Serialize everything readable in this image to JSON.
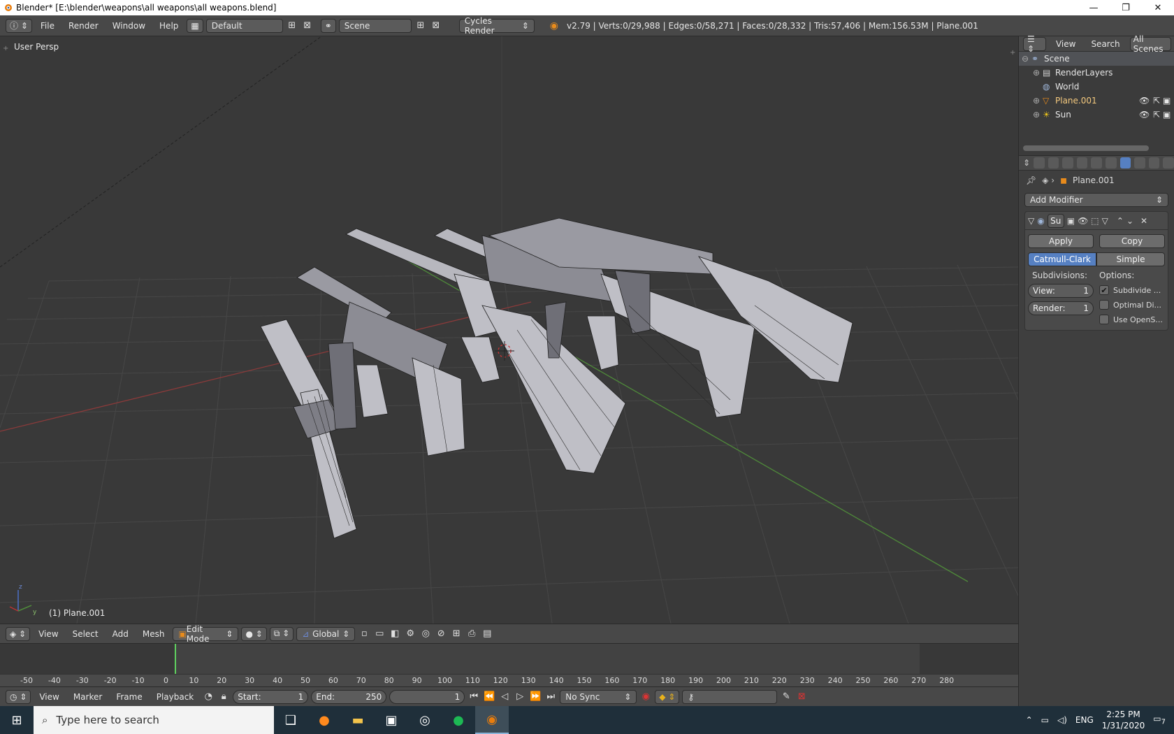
{
  "window": {
    "title": "Blender* [E:\\blender\\weapons\\all weapons\\all weapons.blend]",
    "controls": [
      "—",
      "❐",
      "✕"
    ]
  },
  "info_header": {
    "menus": [
      "File",
      "Render",
      "Window",
      "Help"
    ],
    "layout": "Default",
    "scene": "Scene",
    "engine": "Cycles Render",
    "stats": "v2.79 | Verts:0/29,988 | Edges:0/58,271 | Faces:0/28,332 | Tris:57,406 | Mem:156.53M | Plane.001"
  },
  "viewport": {
    "view_label": "User Persp",
    "object_label": "(1) Plane.001",
    "colors": {
      "background": "#393939",
      "grid": "#4a4a4a",
      "x_axis": "#8a3a3a",
      "y_axis": "#4f8a3a"
    }
  },
  "viewport_header": {
    "menus": [
      "View",
      "Select",
      "Add",
      "Mesh"
    ],
    "mode": "Edit Mode",
    "orientation": "Global"
  },
  "timeline": {
    "ticks": [
      "-50",
      "-40",
      "-30",
      "-20",
      "-10",
      "0",
      "10",
      "20",
      "30",
      "40",
      "50",
      "60",
      "70",
      "80",
      "90",
      "100",
      "110",
      "120",
      "130",
      "140",
      "150",
      "160",
      "170",
      "180",
      "190",
      "200",
      "210",
      "220",
      "230",
      "240",
      "250",
      "260",
      "270",
      "280"
    ],
    "current_frame_value": 0,
    "menus": [
      "View",
      "Marker",
      "Frame",
      "Playback"
    ],
    "start_label": "Start:",
    "start_value": "1",
    "end_label": "End:",
    "end_value": "250",
    "current_frame": "1",
    "sync": "No Sync"
  },
  "outliner": {
    "menus": [
      "View",
      "Search"
    ],
    "filter": "All Scenes",
    "items": [
      {
        "label": "Scene",
        "icon": "scene-icon"
      },
      {
        "label": "RenderLayers",
        "icon": "renderlayers-icon"
      },
      {
        "label": "World",
        "icon": "world-icon"
      },
      {
        "label": "Plane.001",
        "icon": "mesh-icon"
      },
      {
        "label": "Sun",
        "icon": "lamp-icon"
      }
    ]
  },
  "properties": {
    "object_name": "Plane.001",
    "add_modifier": "Add Modifier",
    "modifier_short": "Su",
    "apply": "Apply",
    "copy": "Copy",
    "tab_catmull": "Catmull-Clark",
    "tab_simple": "Simple",
    "subdivisions_label": "Subdivisions:",
    "options_label": "Options:",
    "view_label": "View:",
    "view_value": "1",
    "render_label": "Render:",
    "render_value": "1",
    "option1": "Subdivide ...",
    "option2": "Optimal Di...",
    "option3": "Use OpenS..."
  },
  "taskbar": {
    "search_placeholder": "Type here to search",
    "language": "ENG",
    "time": "2:25 PM",
    "date": "1/31/2020",
    "notifications": "7"
  }
}
